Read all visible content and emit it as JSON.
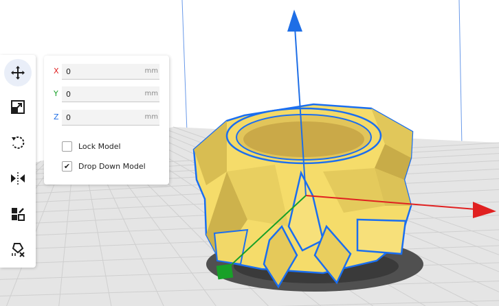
{
  "colors": {
    "accent": "#196ef0",
    "axis_x": "#e02020",
    "axis_y": "#18a028",
    "axis_z": "#1e6ee6",
    "model_fill": "#f5dc6a",
    "model_shade": "#d8b850",
    "outline": "#1a6ef0",
    "build_plate": "#e5e5e5",
    "grid_line": "#cdcdcd"
  },
  "toolbar": {
    "tools": [
      {
        "name": "move",
        "icon": "move-icon",
        "active": true
      },
      {
        "name": "scale",
        "icon": "scale-icon",
        "active": false
      },
      {
        "name": "rotate",
        "icon": "rotate-icon",
        "active": false
      },
      {
        "name": "mirror",
        "icon": "mirror-icon",
        "active": false
      },
      {
        "name": "per-model-settings",
        "icon": "per-model-settings-icon",
        "active": false
      },
      {
        "name": "support-blocker",
        "icon": "support-blocker-icon",
        "active": false
      }
    ]
  },
  "move_panel": {
    "x": {
      "label": "X",
      "value": "0",
      "unit": "mm",
      "color": "#e02020"
    },
    "y": {
      "label": "Y",
      "value": "0",
      "unit": "mm",
      "color": "#18a028"
    },
    "z": {
      "label": "Z",
      "value": "0",
      "unit": "mm",
      "color": "#1e6ee6"
    },
    "lock_model": {
      "label": "Lock Model",
      "checked": false
    },
    "drop_down_model": {
      "label": "Drop Down Model",
      "checked": true
    }
  }
}
